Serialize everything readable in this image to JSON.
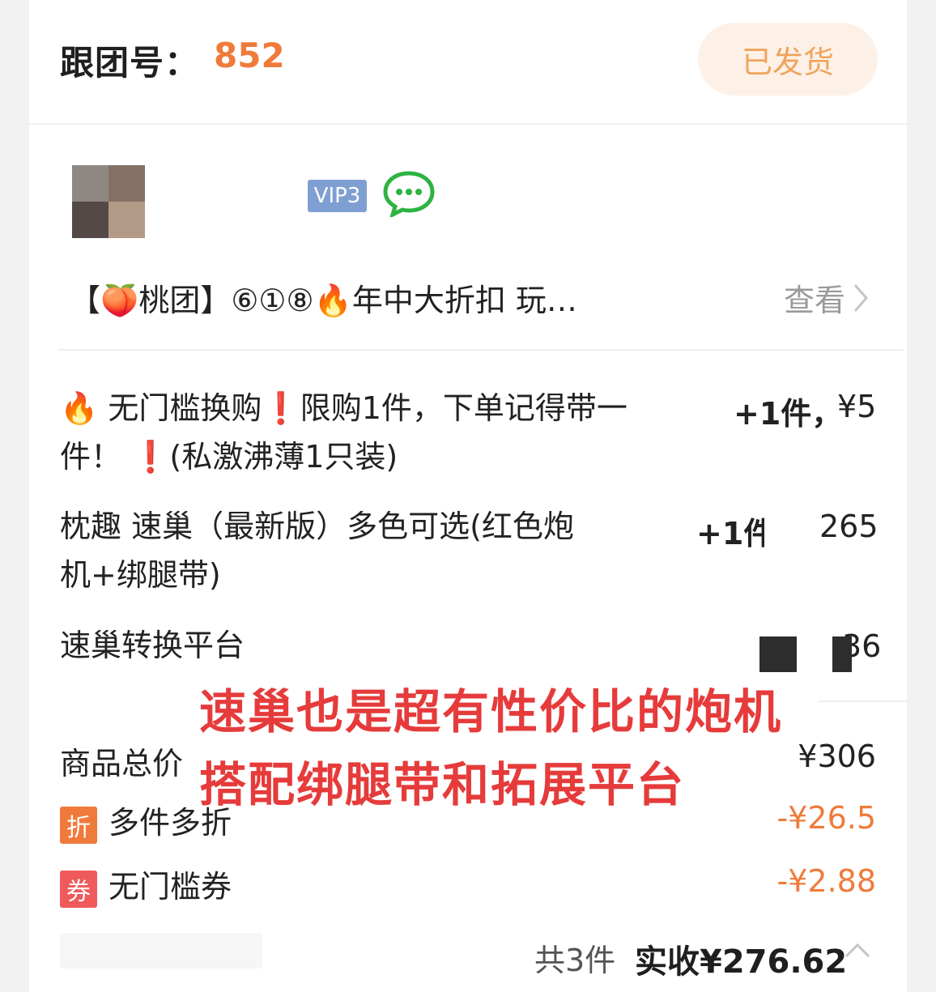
{
  "header": {
    "group_label": "跟团号：",
    "group_number": "852",
    "status": "已发货"
  },
  "user": {
    "vip": "VIP3",
    "chat_icon": "wechat-chat-icon"
  },
  "group": {
    "title": "【🍑桃团】⑥①⑧🔥年中大折扣 玩…",
    "view_label": "查看"
  },
  "items": [
    {
      "name_line1": "🔥 无门槛换购❗限购1件，下单记得带一",
      "name_line2": "件！ ❗(私激沸薄1只装)",
      "qty": "+1件，",
      "price": "¥5"
    },
    {
      "name_line1": "枕趣 速巢（最新版）多色可选(红色炮",
      "name_line2": "机+绑腿带)",
      "qty": "+1件",
      "price": "265"
    },
    {
      "name_line1": "速巢转换平台",
      "price": "36"
    }
  ],
  "overlay": {
    "line1": "速巢也是超有性价比的炮机",
    "line2": "搭配绑腿带和拓展平台"
  },
  "summary": {
    "subtotal_label": "商品总价",
    "subtotal_value": "¥306",
    "discount1_badge": "折",
    "discount1_label": "多件多折",
    "discount1_value": "-¥26.5",
    "discount2_badge": "券",
    "discount2_label": "无门槛券",
    "discount2_value": "-¥2.88",
    "count": "共3件",
    "total": "实收¥276.62"
  },
  "colors": {
    "accent_orange": "#ef7b3a",
    "status_bg": "#fdf1e7",
    "vip_blue": "#7f9fd3",
    "overlay_red": "#e63b3b",
    "badge_orange": "#f07a3c",
    "badge_red": "#ef5a5a"
  }
}
